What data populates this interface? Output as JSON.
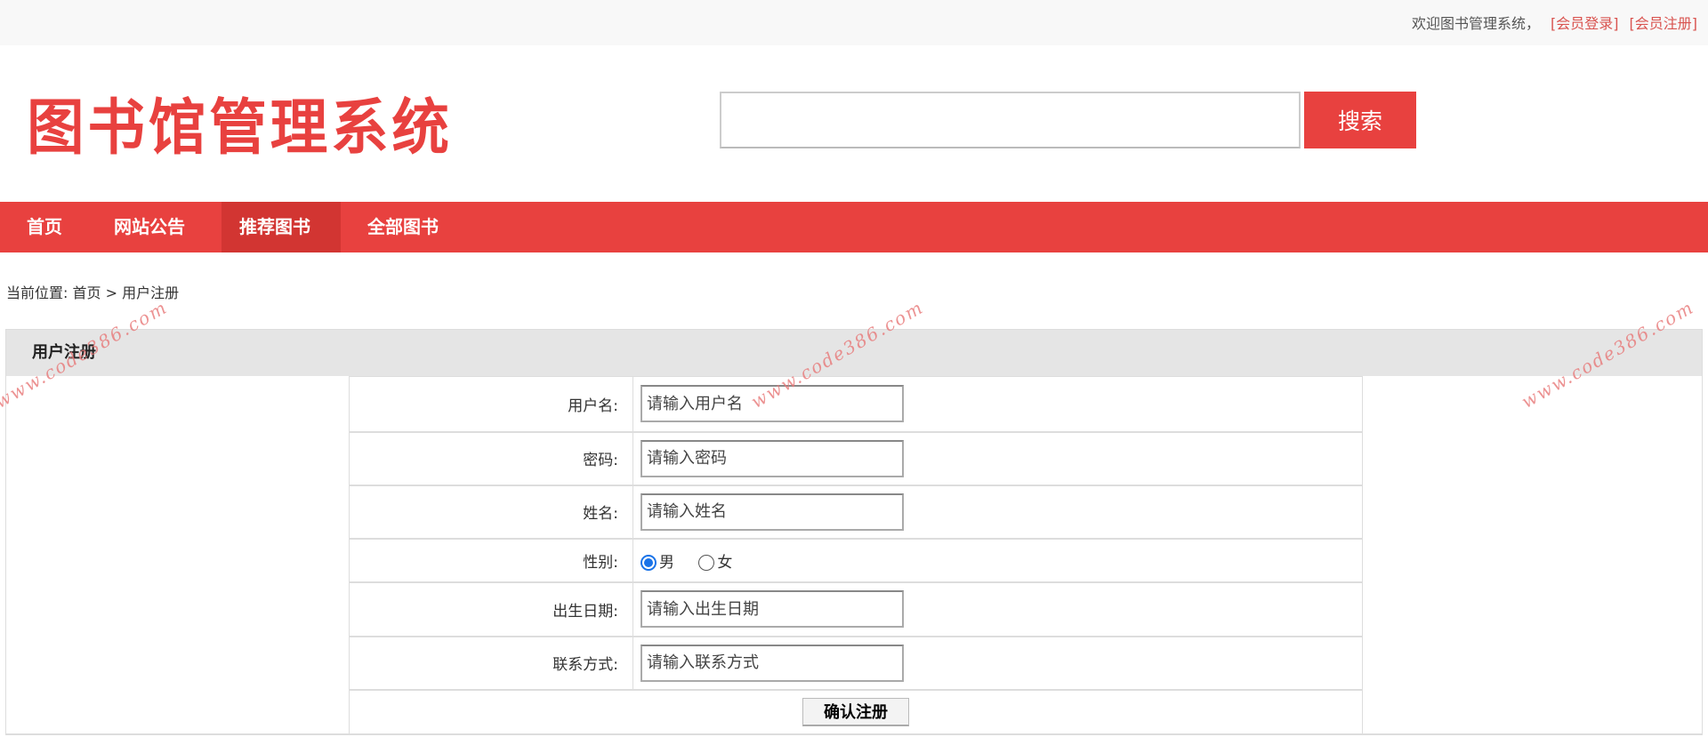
{
  "topbar": {
    "welcome": "欢迎图书管理系统，",
    "login": "[会员登录]",
    "register": "[会员注册]"
  },
  "logo": "图书馆管理系统",
  "search": {
    "value": "",
    "button": "搜索"
  },
  "nav": [
    "首页",
    "网站公告",
    "推荐图书",
    "全部图书"
  ],
  "breadcrumb": {
    "prefix": "当前位置:",
    "home": "首页",
    "sep": ">",
    "current": "用户注册"
  },
  "panel_title": "用户注册",
  "form": {
    "username": {
      "label": "用户名:",
      "placeholder": "请输入用户名"
    },
    "password": {
      "label": "密码:",
      "placeholder": "请输入密码"
    },
    "name": {
      "label": "姓名:",
      "placeholder": "请输入姓名"
    },
    "gender": {
      "label": "性别:",
      "male": "男",
      "female": "女",
      "selected": "男"
    },
    "birthday": {
      "label": "出生日期:",
      "placeholder": "请输入出生日期"
    },
    "contact": {
      "label": "联系方式:",
      "placeholder": "请输入联系方式"
    },
    "submit": "确认注册"
  },
  "watermark": "www.code386.com",
  "colors": {
    "accent": "#e8413f",
    "nav_active": "#d23532",
    "panel_head": "#e5e5e5"
  }
}
